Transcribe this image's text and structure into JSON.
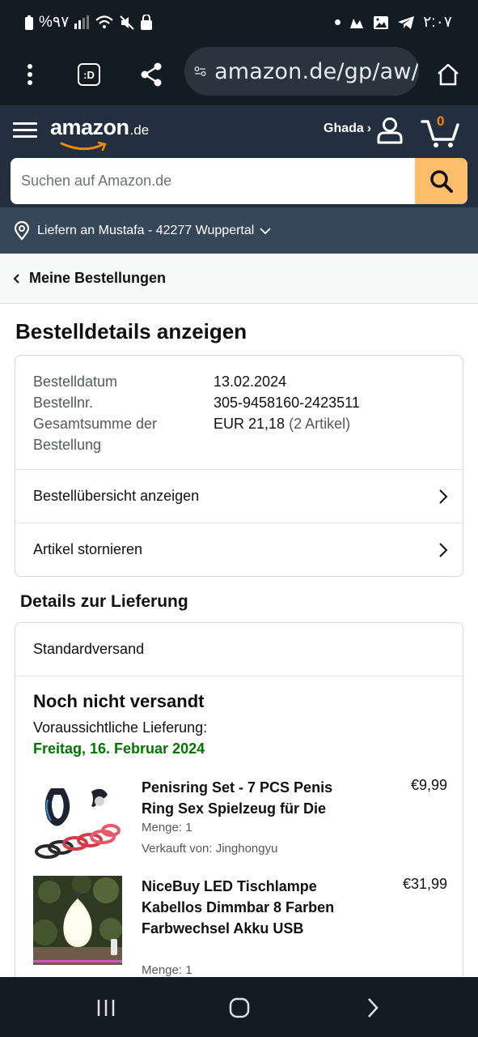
{
  "status_bar": {
    "battery_text": "%٩٧",
    "time": "٢:٠٧"
  },
  "browser": {
    "tab_switch_label": ":D",
    "url": "amazon.de/gp/aw/"
  },
  "header": {
    "logo_text": "amazon",
    "logo_tld": ".de",
    "account_name": "Ghada",
    "account_arrow": "›",
    "cart_count": "0",
    "search_placeholder": "Suchen auf Amazon.de",
    "delivery_text": "Liefern an Mustafa - 42277 Wuppertal"
  },
  "breadcrumb": {
    "label": "Meine Bestellungen"
  },
  "page_title": "Bestelldetails anzeigen",
  "order_info": {
    "date_label": "Bestelldatum",
    "date_value": "13.02.2024",
    "number_label": "Bestellnr.",
    "number_value": "305-9458160-2423511",
    "total_label_line1": "Gesamtsumme der",
    "total_label_line2": "Bestellung",
    "total_value": "EUR 21,18",
    "total_items": "(2 Artikel)"
  },
  "order_links": {
    "overview": "Bestellübersicht anzeigen",
    "cancel": "Artikel stornieren"
  },
  "delivery": {
    "section_title": "Details zur Lieferung",
    "shipping_type": "Standardversand",
    "status": "Noch nicht versandt",
    "eta_label": "Voraussichtliche Lieferung:",
    "eta_date": "Freitag, 16. Februar 2024"
  },
  "items": [
    {
      "title": "Penisring Set - 7 PCS Penis Ring Sex Spielzeug für Die",
      "price": "€9,99",
      "quantity": "Menge: 1",
      "seller": "Verkauft von: Jinghongyu"
    },
    {
      "title": "NiceBuy LED Tischlampe Kabellos Dimmbar 8 Farben Farbwechsel Akku USB",
      "price": "€31,99",
      "quantity": "Menge: 1"
    }
  ],
  "colors": {
    "amazon_dark": "#232f3e",
    "amazon_subnav": "#37475a",
    "search_button": "#febd69",
    "cart_count": "#f08804",
    "delivery_green": "#007600"
  }
}
